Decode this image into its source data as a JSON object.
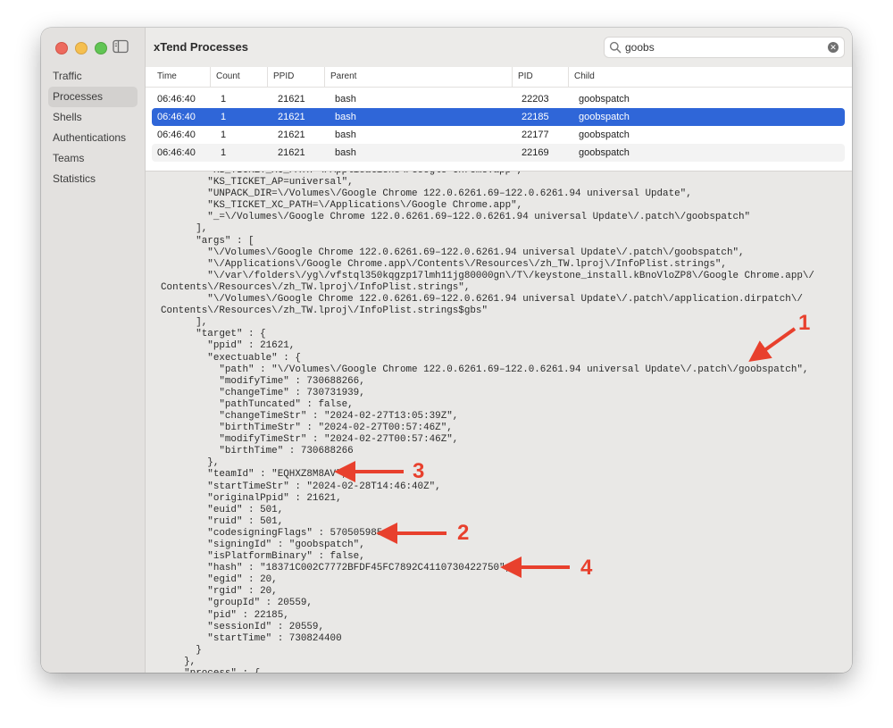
{
  "window": {
    "title": "xTend Processes"
  },
  "search": {
    "value": "goobs",
    "placeholder": "Search"
  },
  "sidebar": {
    "items": [
      {
        "label": "Traffic",
        "active": false
      },
      {
        "label": "Processes",
        "active": true
      },
      {
        "label": "Shells",
        "active": false
      },
      {
        "label": "Authentications",
        "active": false
      },
      {
        "label": "Teams",
        "active": false
      },
      {
        "label": "Statistics",
        "active": false
      }
    ]
  },
  "table": {
    "columns": [
      "Time",
      "Count",
      "PPID",
      "Parent",
      "PID",
      "Child"
    ],
    "rows": [
      {
        "time": "06:46:40",
        "count": "1",
        "ppid": "21621",
        "parent": "bash",
        "pid": "22203",
        "child": "goobspatch"
      },
      {
        "time": "06:46:40",
        "count": "1",
        "ppid": "21621",
        "parent": "bash",
        "pid": "22185",
        "child": "goobspatch"
      },
      {
        "time": "06:46:40",
        "count": "1",
        "ppid": "21621",
        "parent": "bash",
        "pid": "22177",
        "child": "goobspatch"
      },
      {
        "time": "06:46:40",
        "count": "1",
        "ppid": "21621",
        "parent": "bash",
        "pid": "22169",
        "child": "goobspatch"
      }
    ],
    "selected_index": 1
  },
  "detail": {
    "lines": [
      "        \"KS_TICKET_XC_PATH=\\/Applications\\/Google Chrome.app\",",
      "        \"KS_TICKET_AP=universal\",",
      "        \"UNPACK_DIR=\\/Volumes\\/Google Chrome 122.0.6261.69–122.0.6261.94 universal Update\",",
      "        \"KS_TICKET_XC_PATH=\\/Applications\\/Google Chrome.app\",",
      "        \"_=\\/Volumes\\/Google Chrome 122.0.6261.69–122.0.6261.94 universal Update\\/.patch\\/goobspatch\"",
      "      ],",
      "      \"args\" : [",
      "        \"\\/Volumes\\/Google Chrome 122.0.6261.69–122.0.6261.94 universal Update\\/.patch\\/goobspatch\",",
      "        \"\\/Applications\\/Google Chrome.app\\/Contents\\/Resources\\/zh_TW.lproj\\/InfoPlist.strings\",",
      "        \"\\/var\\/folders\\/yg\\/vfstql350kqgzp17lmh11jg80000gn\\/T\\/keystone_install.kBnoVloZP8\\/Google Chrome.app\\/",
      "Contents\\/Resources\\/zh_TW.lproj\\/InfoPlist.strings\",",
      "        \"\\/Volumes\\/Google Chrome 122.0.6261.69–122.0.6261.94 universal Update\\/.patch\\/application.dirpatch\\/",
      "Contents\\/Resources\\/zh_TW.lproj\\/InfoPlist.strings$gbs\"",
      "      ],",
      "      \"target\" : {",
      "        \"ppid\" : 21621,",
      "        \"exectuable\" : {",
      "          \"path\" : \"\\/Volumes\\/Google Chrome 122.0.6261.69–122.0.6261.94 universal Update\\/.patch\\/goobspatch\",",
      "          \"modifyTime\" : 730688266,",
      "          \"changeTime\" : 730731939,",
      "          \"pathTuncated\" : false,",
      "          \"changeTimeStr\" : \"2024-02-27T13:05:39Z\",",
      "          \"birthTimeStr\" : \"2024-02-27T00:57:46Z\",",
      "          \"modifyTimeStr\" : \"2024-02-27T00:57:46Z\",",
      "          \"birthTime\" : 730688266",
      "        },",
      "        \"teamId\" : \"EQHXZ8M8AV\",",
      "        \"startTimeStr\" : \"2024-02-28T14:46:40Z\",",
      "        \"originalPpid\" : 21621,",
      "        \"euid\" : 501,",
      "        \"ruid\" : 501,",
      "        \"codesigningFlags\" : 570505985,",
      "        \"signingId\" : \"goobspatch\",",
      "        \"isPlatformBinary\" : false,",
      "        \"hash\" : \"18371C002C7772BFDF45FC7892C4110730422750\",",
      "        \"egid\" : 20,",
      "        \"rgid\" : 20,",
      "        \"groupId\" : 20559,",
      "        \"pid\" : 22185,",
      "        \"sessionId\" : 20559,",
      "        \"startTime\" : 730824400",
      "      }",
      "    },",
      "    \"process\" : {"
    ]
  },
  "annotations": [
    "1",
    "2",
    "3",
    "4"
  ],
  "colors": {
    "selection": "#2f66d8",
    "annotation": "#e8402d"
  }
}
